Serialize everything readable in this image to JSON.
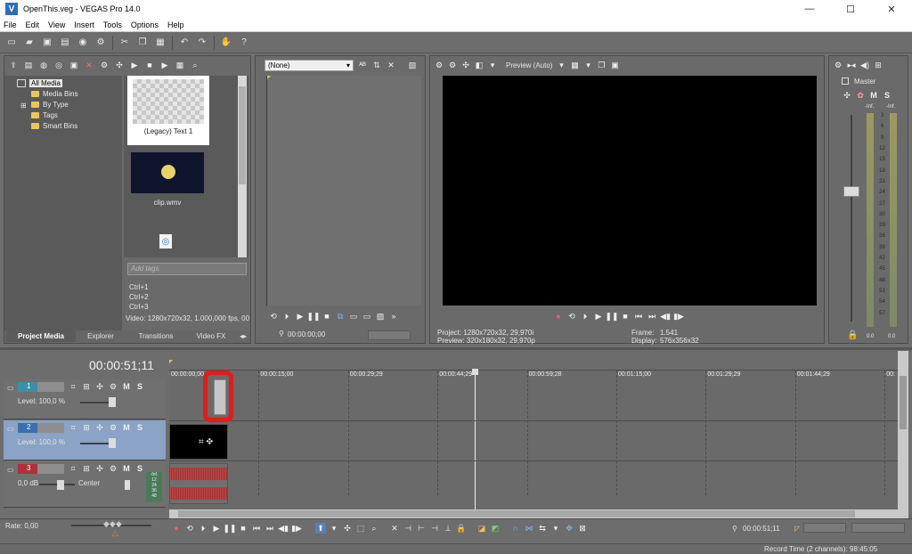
{
  "window": {
    "title": "OpenThis.veg - VEGAS Pro 14.0",
    "icon": "vegas-icon",
    "controls": [
      "—",
      "☐",
      "✕"
    ]
  },
  "menu": [
    "File",
    "Edit",
    "View",
    "Insert",
    "Tools",
    "Options",
    "Help"
  ],
  "media": {
    "tree": [
      "All Media",
      "Media Bins",
      "By Type",
      "Tags",
      "Smart Bins"
    ],
    "thumbs": [
      {
        "label": "(Legacy) Text 1",
        "kind": "checker"
      },
      {
        "label": "clip.wmv",
        "kind": "video"
      }
    ],
    "tags_placeholder": "Add tags",
    "shortcuts": [
      "Ctrl+1",
      "Ctrl+2",
      "Ctrl+3"
    ],
    "info": "Video: 1280x720x32, 1.000,000 fps, 00",
    "tabs": [
      "Project Media",
      "Explorer",
      "Transitions",
      "Video FX"
    ]
  },
  "trimmer": {
    "select": "(None)",
    "time": "00:00:00;00"
  },
  "preview": {
    "mode": "Preview (Auto)",
    "project_label": "Project:",
    "project_value": "1280x720x32, 29,970i",
    "preview_label": "Preview:",
    "preview_value": "320x180x32, 29,970p",
    "frame_label": "Frame:",
    "frame_value": "1.541",
    "display_label": "Display:",
    "display_value": "576x356x32"
  },
  "master": {
    "title": "Master",
    "mute": "M",
    "solo": "S",
    "peak_left": "-Inf.",
    "peak_right": "-Inf.",
    "scale": [
      "3",
      "6",
      "9",
      "12",
      "15",
      "18",
      "21",
      "24",
      "27",
      "30",
      "33",
      "36",
      "39",
      "42",
      "45",
      "48",
      "51",
      "54",
      "57"
    ],
    "out_left": "0.0",
    "out_right": "0.0"
  },
  "timeline": {
    "time": "00:00:51;11",
    "ruler": [
      "00:00:00;00",
      "00:00:15;00",
      "00:00:29;29",
      "00:00:44;29",
      "00:00:59;28",
      "00:01:15;00",
      "00:01:29;29",
      "00:01:44;29",
      "00:"
    ],
    "tracks": [
      {
        "num": "1",
        "level": "Level: 100,0 %",
        "m": "M",
        "s": "S",
        "color": "#3b8fa8"
      },
      {
        "num": "2",
        "level": "Level: 100,0 %",
        "m": "M",
        "s": "S",
        "color": "#3b6fb0"
      },
      {
        "num": "3",
        "level": "0,0 dB",
        "pan": "Center",
        "m": "M",
        "s": "S",
        "color": "#b0303a",
        "meter": [
          "-Inf.",
          "12",
          "24",
          "36",
          "48"
        ]
      }
    ],
    "rate": "Rate: 0,00",
    "transport_time": "00:00:51;11",
    "record_time": "Record Time (2 channels): 98:45:05"
  },
  "colors": {
    "bg": "#6f6f6f",
    "panel": "#6a6a6a",
    "accent": "#3b6fb0",
    "annotation": "#e31b1b"
  }
}
